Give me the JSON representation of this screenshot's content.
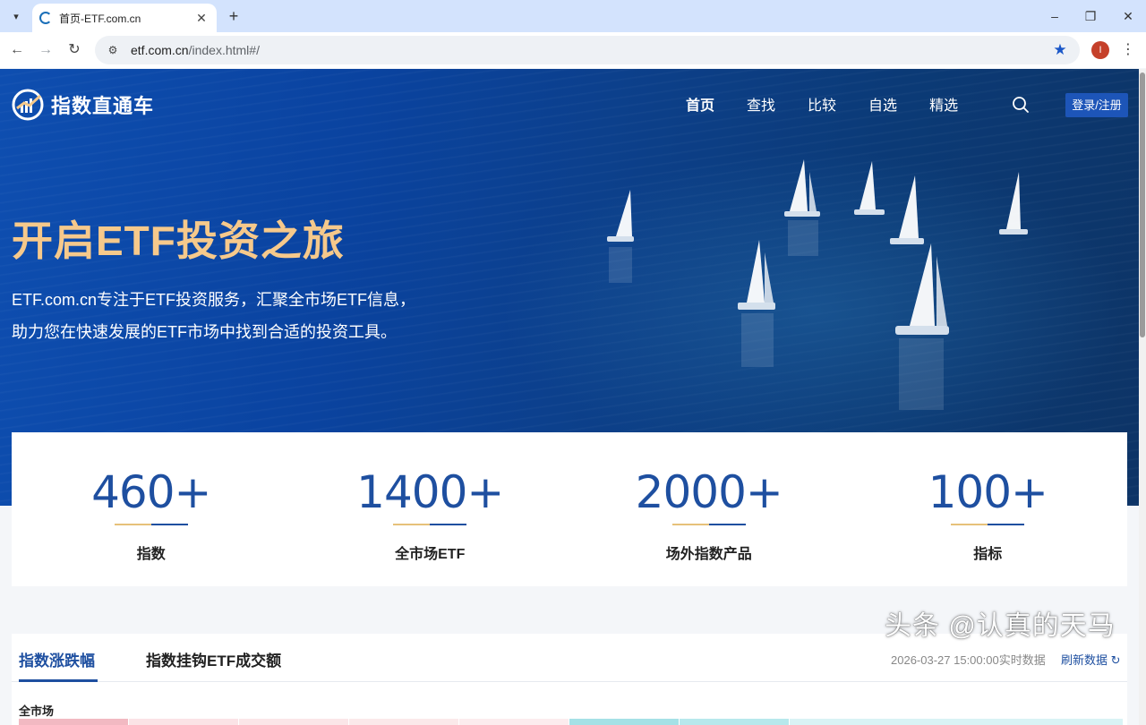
{
  "browser": {
    "tab_title": "首页-ETF.com.cn",
    "url_host": "etf.com.cn",
    "url_path": "/index.html#/",
    "profile_initial": "I",
    "icons": [
      "tab-search-icon",
      "favicon-icon",
      "close-icon",
      "plus-icon",
      "minimize-icon",
      "restore-icon",
      "back-icon",
      "forward-icon",
      "reload-icon",
      "site-info-icon",
      "star-icon",
      "more-vert-icon"
    ],
    "accent": "#1a57c8"
  },
  "site": {
    "logo_text": "指数直通车",
    "nav": [
      {
        "label": "首页",
        "active": true
      },
      {
        "label": "查找",
        "active": false
      },
      {
        "label": "比较",
        "active": false
      },
      {
        "label": "自选",
        "active": false
      },
      {
        "label": "精选",
        "active": false
      }
    ],
    "login_label": "登录/注册",
    "hero_title": "开启ETF投资之旅",
    "hero_desc_line1": "ETF.com.cn专注于ETF投资服务，汇聚全市场ETF信息，",
    "hero_desc_line2": "助力您在快速发展的ETF市场中找到合适的投资工具。",
    "colors": {
      "brand_blue": "#1e4fa0",
      "hero_gold": "#f6c98b",
      "login_bg": "#1d55b8"
    }
  },
  "stats": [
    {
      "value": "460+",
      "label": "指数"
    },
    {
      "value": "1400+",
      "label": "全市场ETF"
    },
    {
      "value": "2000+",
      "label": "场外指数产品"
    },
    {
      "value": "100+",
      "label": "指标"
    }
  ],
  "panel": {
    "tabs": [
      {
        "label": "指数涨跌幅",
        "active": true
      },
      {
        "label": "指数挂钩ETF成交额",
        "active": false
      }
    ],
    "data_time": "2026-03-27 15:00:00实时数据",
    "refresh_label": "刷新数据",
    "market_label": "全市场",
    "market_segments": [
      {
        "color": "#f2b9c2"
      },
      {
        "color": "#fbe3e6"
      },
      {
        "color": "#fbe6e8"
      },
      {
        "color": "#fbe9ea"
      },
      {
        "color": "#fcecee"
      },
      {
        "color": "#a5e1e6"
      },
      {
        "color": "#b7e8ec"
      },
      {
        "color": "#d9f3f5"
      }
    ]
  },
  "watermark": "头条 @认真的天马"
}
